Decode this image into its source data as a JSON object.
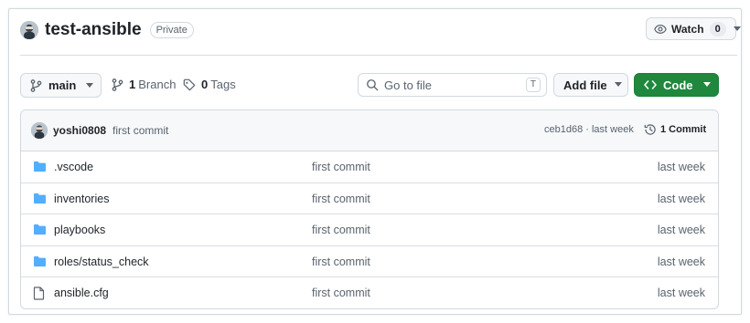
{
  "repo": {
    "name": "test-ansible",
    "visibility": "Private",
    "watch_label": "Watch",
    "watch_count": "0"
  },
  "toolbar": {
    "branch": "main",
    "branch_count": "1",
    "branch_label": "Branch",
    "tag_count": "0",
    "tag_label": "Tags",
    "search_placeholder": "Go to file",
    "search_shortcut": "T",
    "add_file_label": "Add file",
    "code_label": "Code"
  },
  "latest_commit": {
    "author": "yoshi0808",
    "message": "first commit",
    "hash_and_time": "ceb1d68 · last week",
    "commit_count_label": "1 Commit"
  },
  "files": [
    {
      "name": ".vscode",
      "type": "folder-icon",
      "commit": "first commit",
      "time": "last week"
    },
    {
      "name": "inventories",
      "type": "folder-icon",
      "commit": "first commit",
      "time": "last week"
    },
    {
      "name": "playbooks",
      "type": "folder-icon",
      "commit": "first commit",
      "time": "last week"
    },
    {
      "name": "roles/status_check",
      "type": "folder-icon",
      "commit": "first commit",
      "time": "last week"
    },
    {
      "name": "ansible.cfg",
      "type": "file-icon",
      "commit": "first commit",
      "time": "last week"
    }
  ],
  "colors": {
    "primary_button": "#1f883d",
    "folder_icon": "#54aeff",
    "border": "#d1d9e0",
    "muted_text": "#59636e"
  }
}
